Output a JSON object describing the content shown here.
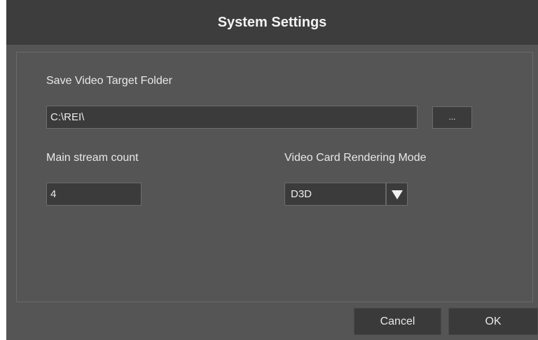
{
  "dialog": {
    "title": "System Settings"
  },
  "save_folder": {
    "label": "Save Video Target Folder",
    "value": "C:\\REI\\",
    "browse_label": "..."
  },
  "main_stream": {
    "label": "Main stream count",
    "value": "4"
  },
  "render_mode": {
    "label": "Video Card Rendering Mode",
    "selected": "D3D",
    "arrow_icon": "triangle-down-icon"
  },
  "footer": {
    "cancel_label": "Cancel",
    "ok_label": "OK"
  }
}
